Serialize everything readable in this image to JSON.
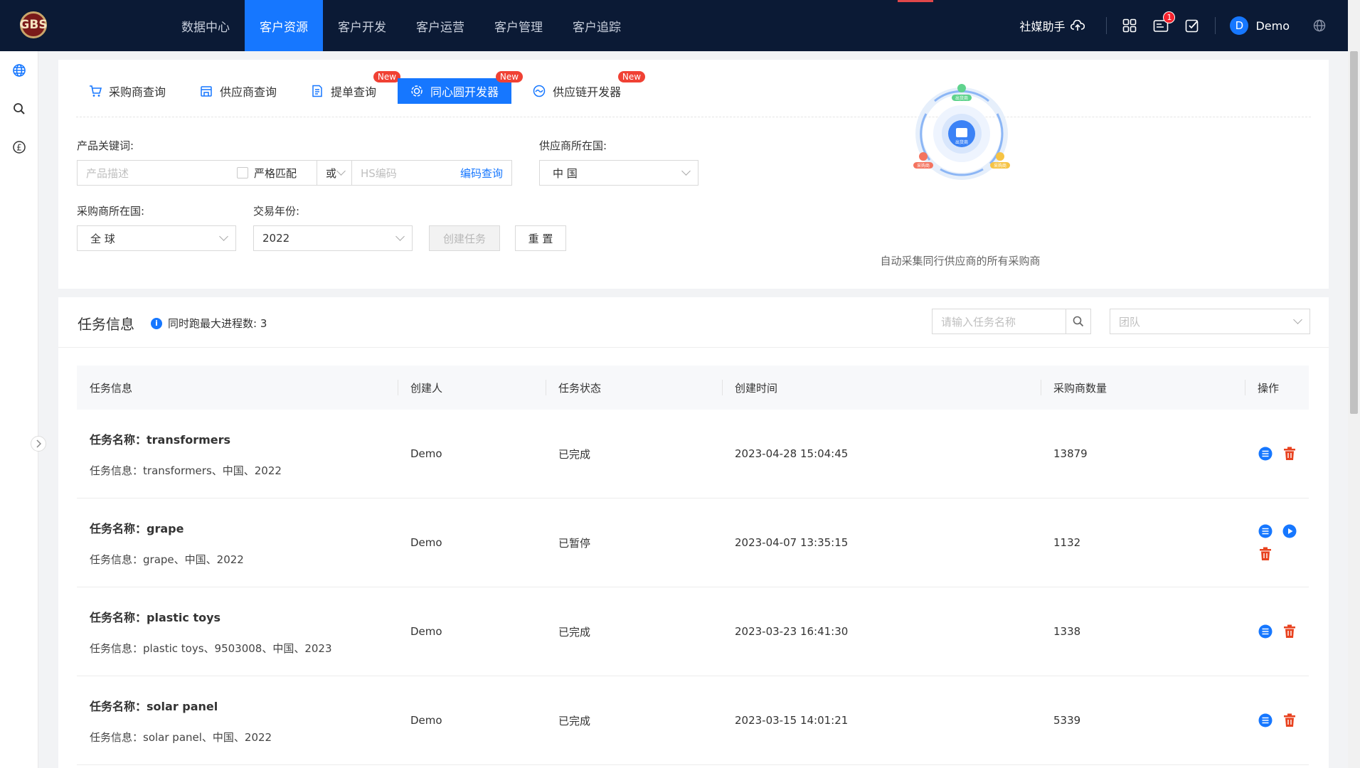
{
  "brand": {
    "logo_text": "GBS"
  },
  "nav": {
    "items": [
      {
        "label": "数据中心",
        "active": false
      },
      {
        "label": "客户资源",
        "active": true
      },
      {
        "label": "客户开发",
        "active": false
      },
      {
        "label": "客户运营",
        "active": false
      },
      {
        "label": "客户管理",
        "active": false
      },
      {
        "label": "客户追踪",
        "active": false
      }
    ]
  },
  "topbar": {
    "social_label": "社媒助手",
    "message_badge": "1",
    "user_initial": "D",
    "user_name": "Demo"
  },
  "sidebar": {
    "icons": [
      "globe-icon",
      "search-icon",
      "pound-icon"
    ]
  },
  "tabs": [
    {
      "label": "采购商查询",
      "icon": "cart-icon",
      "new": false,
      "active": false
    },
    {
      "label": "供应商查询",
      "icon": "store-icon",
      "new": false,
      "active": false
    },
    {
      "label": "提单查询",
      "icon": "document-icon",
      "new": true,
      "active": false
    },
    {
      "label": "同心圆开发器",
      "icon": "concentric-icon",
      "new": true,
      "active": true
    },
    {
      "label": "供应链开发器",
      "icon": "chain-icon",
      "new": true,
      "active": false
    }
  ],
  "new_badge": "New",
  "form": {
    "keyword_label": "产品关键词:",
    "keyword_placeholder": "产品描述",
    "strict_label": "严格匹配",
    "or_value": "或",
    "hs_placeholder": "HS编码",
    "hs_link": "编码查询",
    "supplier_country_label": "供应商所在国:",
    "supplier_country_value": "中 国",
    "buyer_country_label": "采购商所在国:",
    "buyer_country_value": "全 球",
    "year_label": "交易年份:",
    "year_value": "2022",
    "create_button": "创建任务",
    "reset_button": "重 置"
  },
  "diagram": {
    "caption": "自动采集同行供应商的所有采购商",
    "center_label": "出货商",
    "node_top": "出货商",
    "node_left": "采购商",
    "node_right": "采购商"
  },
  "tasks_panel": {
    "title": "任务信息",
    "max_processes_label": "同时跑最大进程数: 3",
    "search_placeholder": "请输入任务名称",
    "team_placeholder": "团队",
    "columns": [
      "任务信息",
      "创建人",
      "任务状态",
      "创建时间",
      "采购商数量",
      "操作"
    ],
    "name_prefix": "任务名称：",
    "info_prefix": "任务信息：",
    "rows": [
      {
        "name": "transformers",
        "info": "transformers、中国、2022",
        "creator": "Demo",
        "status": "已完成",
        "created": "2023-04-28 15:04:45",
        "count": "13879",
        "ops": [
          "list-icon",
          "delete-icon"
        ]
      },
      {
        "name": "grape",
        "info": "grape、中国、2022",
        "creator": "Demo",
        "status": "已暂停",
        "created": "2023-04-07 13:35:15",
        "count": "1132",
        "ops": [
          "list-icon",
          "play-icon",
          "delete-icon"
        ]
      },
      {
        "name": "plastic toys",
        "info": "plastic toys、9503008、中国、2023",
        "creator": "Demo",
        "status": "已完成",
        "created": "2023-03-23 16:41:30",
        "count": "1338",
        "ops": [
          "list-icon",
          "delete-icon"
        ]
      },
      {
        "name": "solar panel",
        "info": "solar panel、中国、2022",
        "creator": "Demo",
        "status": "已完成",
        "created": "2023-03-15 14:01:21",
        "count": "5339",
        "ops": [
          "list-icon",
          "delete-icon"
        ]
      }
    ]
  },
  "colors": {
    "primary": "#1677ff",
    "topbar": "#0b1a35",
    "danger": "#f04134",
    "delete": "#e8421f"
  }
}
